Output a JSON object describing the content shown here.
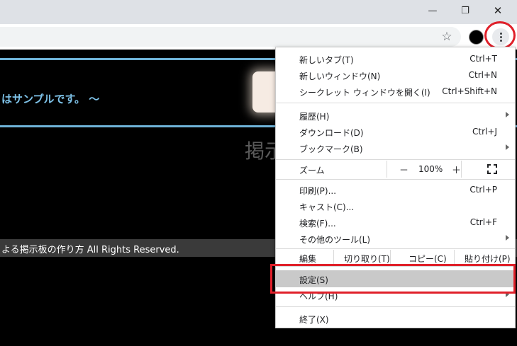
{
  "window": {
    "minimize_glyph": "—",
    "restore_glyph": "❐",
    "close_glyph": "✕"
  },
  "toolbar": {
    "bookmark_glyph": "☆"
  },
  "page": {
    "banner_text": "はサンプルです。 ～",
    "faded_title": "掲示",
    "footer_text": "よる掲示板の作り方 All Rights Reserved.",
    "background_color": "#000000",
    "accent_color": "#6fb3d8"
  },
  "menu": {
    "new_tab": {
      "label": "新しいタブ(T)",
      "shortcut": "Ctrl+T"
    },
    "new_window": {
      "label": "新しいウィンドウ(N)",
      "shortcut": "Ctrl+N"
    },
    "incognito": {
      "label": "シークレット ウィンドウを開く(I)",
      "shortcut": "Ctrl+Shift+N"
    },
    "history": {
      "label": "履歴(H)"
    },
    "downloads": {
      "label": "ダウンロード(D)",
      "shortcut": "Ctrl+J"
    },
    "bookmarks": {
      "label": "ブックマーク(B)"
    },
    "zoom": {
      "label": "ズーム",
      "minus": "－",
      "value": "100%",
      "plus": "＋"
    },
    "print": {
      "label": "印刷(P)...",
      "shortcut": "Ctrl+P"
    },
    "cast": {
      "label": "キャスト(C)..."
    },
    "find": {
      "label": "検索(F)...",
      "shortcut": "Ctrl+F"
    },
    "more_tools": {
      "label": "その他のツール(L)"
    },
    "edit": {
      "label": "編集",
      "cut": "切り取り(T)",
      "copy": "コピー(C)",
      "paste": "貼り付け(P)"
    },
    "settings": {
      "label": "設定(S)"
    },
    "help": {
      "label": "ヘルプ(H)"
    },
    "exit": {
      "label": "終了(X)"
    },
    "highlight_color": "#c9c9c9",
    "annotation_color": "#e0202a"
  }
}
